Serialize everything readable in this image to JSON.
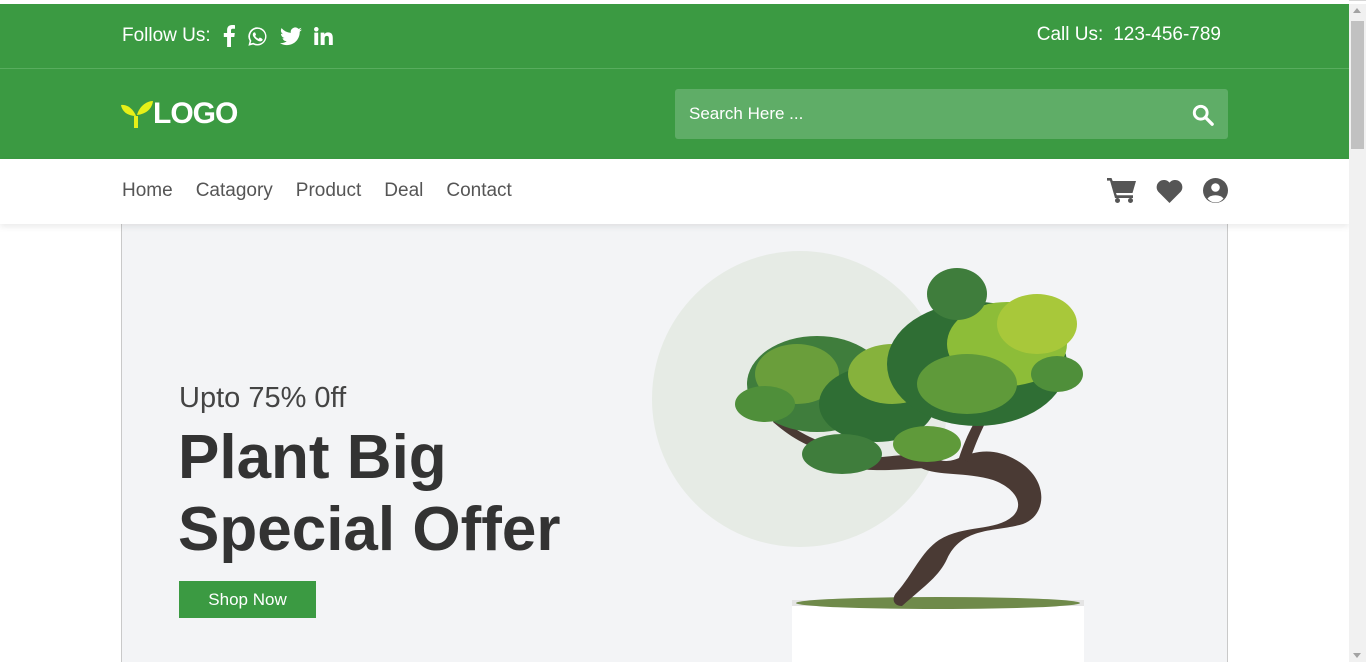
{
  "topbar": {
    "follow_label": "Follow Us:",
    "social": [
      "facebook-icon",
      "whatsapp-icon",
      "twitter-icon",
      "linkedin-icon"
    ],
    "call_label": "Call Us:",
    "phone": "123-456-789"
  },
  "header": {
    "logo_text": "LOGO",
    "logo_icon": "sprout-icon",
    "search_placeholder": "Search Here ...",
    "search_value": ""
  },
  "nav": {
    "items": [
      "Home",
      "Catagory",
      "Product",
      "Deal",
      "Contact"
    ],
    "icons": [
      "cart-icon",
      "heart-icon",
      "user-icon"
    ]
  },
  "hero": {
    "subtitle": "Upto 75% 0ff",
    "title": "Plant Big Special Offer",
    "button_label": "Shop Now"
  },
  "colors": {
    "brand_green": "#3b9a42",
    "search_bg": "#5fad67",
    "logo_accent": "#e6f018",
    "hero_bg": "#f3f4f6",
    "text_dark": "#333333",
    "nav_text": "#555555"
  }
}
